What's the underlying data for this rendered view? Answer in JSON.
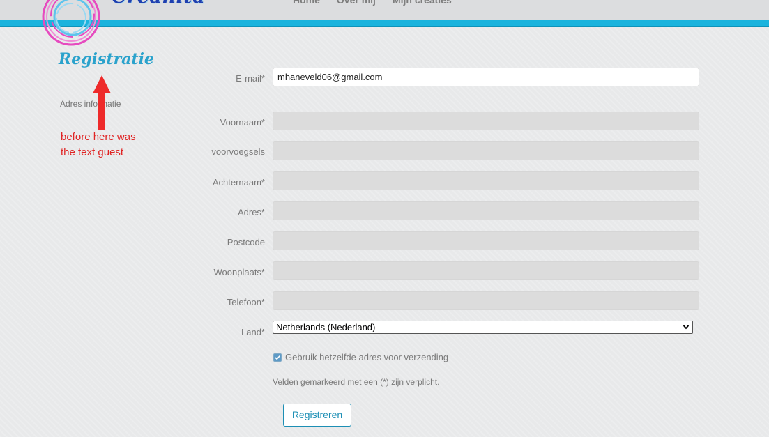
{
  "nav": {
    "items": [
      "Home",
      "Over mij",
      "Mijn creaties"
    ]
  },
  "brand": {
    "logo_text": "Creanita"
  },
  "page": {
    "title": "Registratie",
    "side_label": "Adres informatie"
  },
  "annotation": {
    "line1": "before here was",
    "line2": "the text guest"
  },
  "form": {
    "email_label": "E-mail*",
    "email_value": "mhaneveld06@gmail.com",
    "voornaam_label": "Voornaam*",
    "voorvoegsels_label": "voorvoegsels",
    "achternaam_label": "Achternaam*",
    "adres_label": "Adres*",
    "postcode_label": "Postcode",
    "woonplaats_label": "Woonplaats*",
    "telefoon_label": "Telefoon*",
    "land_label": "Land*",
    "land_value": "Netherlands (Nederland)",
    "same_address_label": "Gebruik hetzelfde adres voor verzending",
    "required_note": "Velden gemarkeerd met een (*) zijn verplicht.",
    "submit_label": "Registreren"
  },
  "colors": {
    "accent": "#1ab3dd",
    "annotation_red": "#e02424",
    "title_blue": "#2aa2cc",
    "logo_blue": "#1f3fb0",
    "logo_pink": "#e64bbf"
  }
}
